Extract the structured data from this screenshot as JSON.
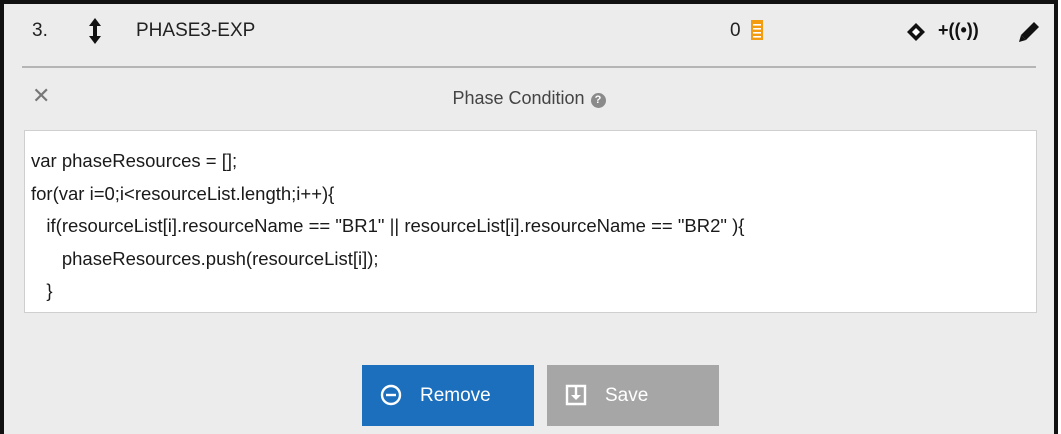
{
  "phase": {
    "number": "3.",
    "name": "PHASE3-EXP",
    "count": "0",
    "broadcast_label": "+((•))"
  },
  "condition": {
    "title": "Phase Condition",
    "help_glyph": "?",
    "close_glyph": "✕",
    "code_lines": [
      "var phaseResources = [];",
      "for(var i=0;i<resourceList.length;i++){",
      "   if(resourceList[i].resourceName == \"BR1\" || resourceList[i].resourceName == \"BR2\" ){",
      "      phaseResources.push(resourceList[i]);",
      "   }"
    ]
  },
  "actions": {
    "remove_label": "Remove",
    "save_label": "Save"
  },
  "colors": {
    "remove_bg": "#1c6fbd",
    "save_bg": "#a6a6a6",
    "doc_icon": "#f39c12",
    "panel_bg": "#ececec"
  },
  "icons": {
    "reorder": "up-down-arrow-icon",
    "count_doc": "document-icon",
    "diamond": "diamond-icon",
    "broadcast": "broadcast-icon",
    "edit": "pencil-icon",
    "close": "close-icon",
    "help": "help-icon",
    "remove": "minus-circle-icon",
    "save": "save-icon"
  }
}
